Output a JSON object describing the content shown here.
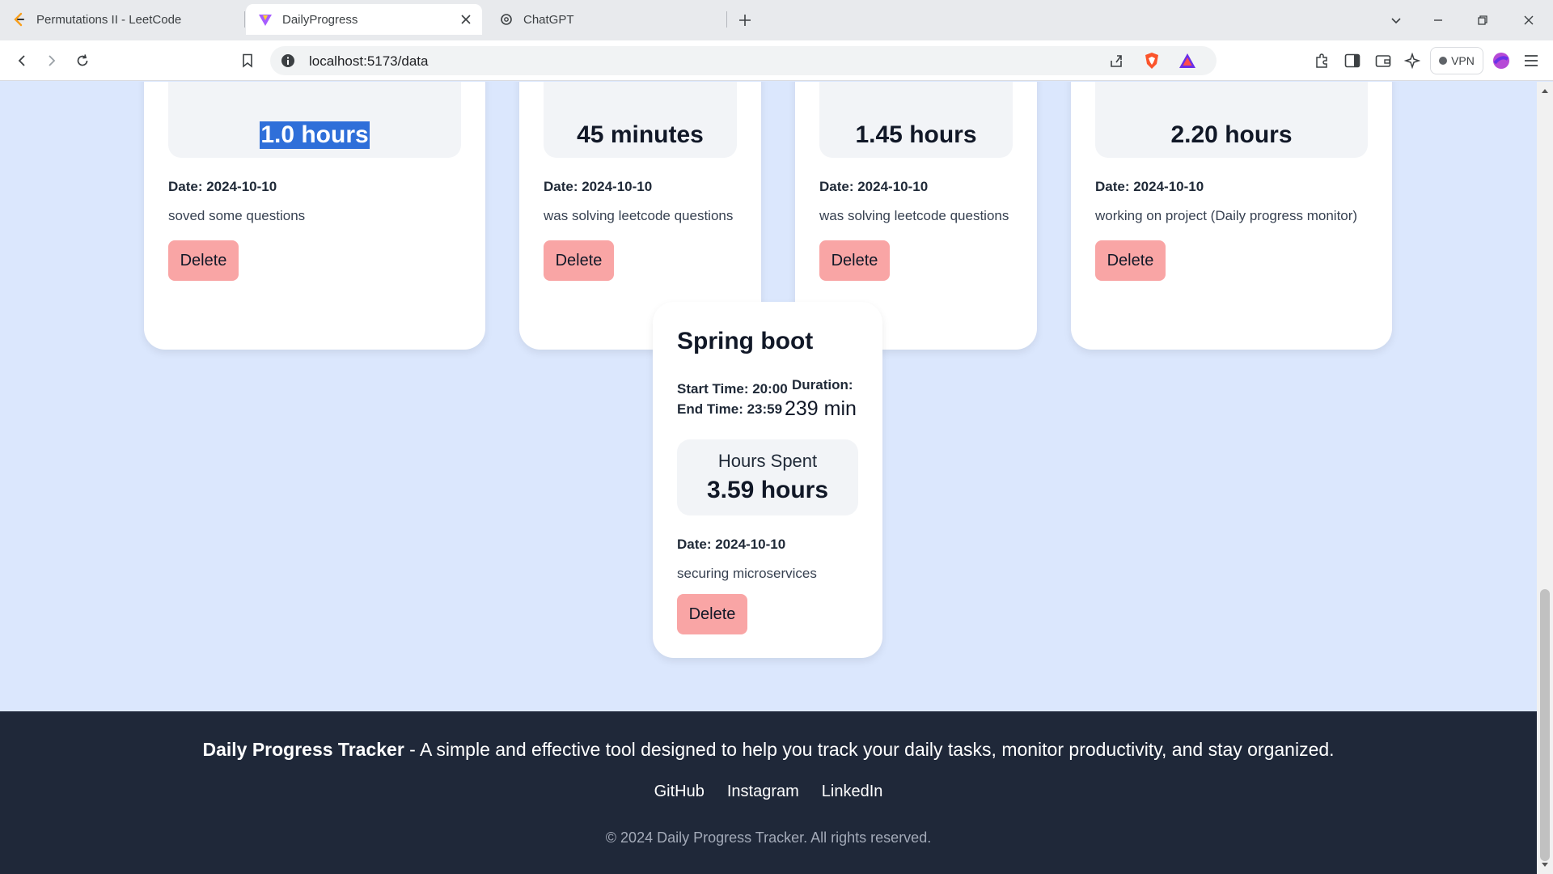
{
  "browser": {
    "tabs": [
      {
        "title": "Permutations II - LeetCode"
      },
      {
        "title": "DailyProgress"
      },
      {
        "title": "ChatGPT"
      }
    ],
    "url": "localhost:5173/data",
    "vpn_label": "VPN"
  },
  "top_cards": [
    {
      "hours": "1.0 hours",
      "date": "Date: 2024-10-10",
      "description": "soved some questions",
      "delete_label": "Delete"
    },
    {
      "hours": "45 minutes",
      "date": "Date: 2024-10-10",
      "description": "was solving leetcode questions",
      "delete_label": "Delete"
    },
    {
      "hours": "1.45 hours",
      "date": "Date: 2024-10-10",
      "description": "was solving leetcode questions",
      "delete_label": "Delete"
    },
    {
      "hours": "2.20 hours",
      "date": "Date: 2024-10-10",
      "description": "working on project (Daily progress monitor)",
      "delete_label": "Delete"
    }
  ],
  "spring_card": {
    "title": "Spring boot",
    "start_time": "Start Time: 20:00",
    "end_time": "End Time: 23:59",
    "duration_label": "Duration:",
    "duration_value": "239 min",
    "hours_spent_label": "Hours Spent",
    "hours": "3.59 hours",
    "date": "Date: 2024-10-10",
    "description": "securing microservices",
    "delete_label": "Delete"
  },
  "footer": {
    "brand": "Daily Progress Tracker",
    "tagline": " - A simple and effective tool designed to help you track your daily tasks, monitor productivity, and stay organized.",
    "links": [
      "GitHub",
      "Instagram",
      "LinkedIn"
    ],
    "copyright": "© 2024 Daily Progress Tracker. All rights reserved."
  }
}
